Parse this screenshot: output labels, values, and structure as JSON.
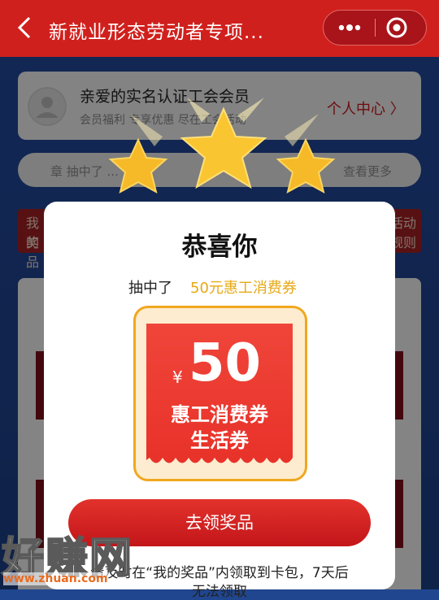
{
  "nav": {
    "title": "新就业形态劳动者专项..."
  },
  "member": {
    "title": "亲爱的实名认证工会会员",
    "subtitle": "会员福利 专享优惠 尽在工会活动",
    "personal_center": "个人中心 〉"
  },
  "notice": {
    "text": "章 抽中了 ...",
    "view_more": "查看更多"
  },
  "side_left": {
    "line1": "我的",
    "line2": "奖品"
  },
  "side_right": {
    "line1": "活动",
    "line2": "规则"
  },
  "modal": {
    "title": "恭喜你",
    "sub_prefix": "抽中了",
    "prize_name": "50元惠工消费券",
    "coupon": {
      "currency": "¥",
      "amount": "50",
      "line1": "惠工消费券",
      "line2": "生活券"
    },
    "button": "去领奖品",
    "footer_line1": "请及时在“我的奖品”内领取到卡包，7天后",
    "footer_line2": "无法领取"
  },
  "watermark": {
    "text": "好赚网",
    "url": "www.zhuan.com"
  },
  "colors": {
    "brand_red": "#d0201d",
    "gold": "#e7a916",
    "page_blue": "#20468f"
  }
}
